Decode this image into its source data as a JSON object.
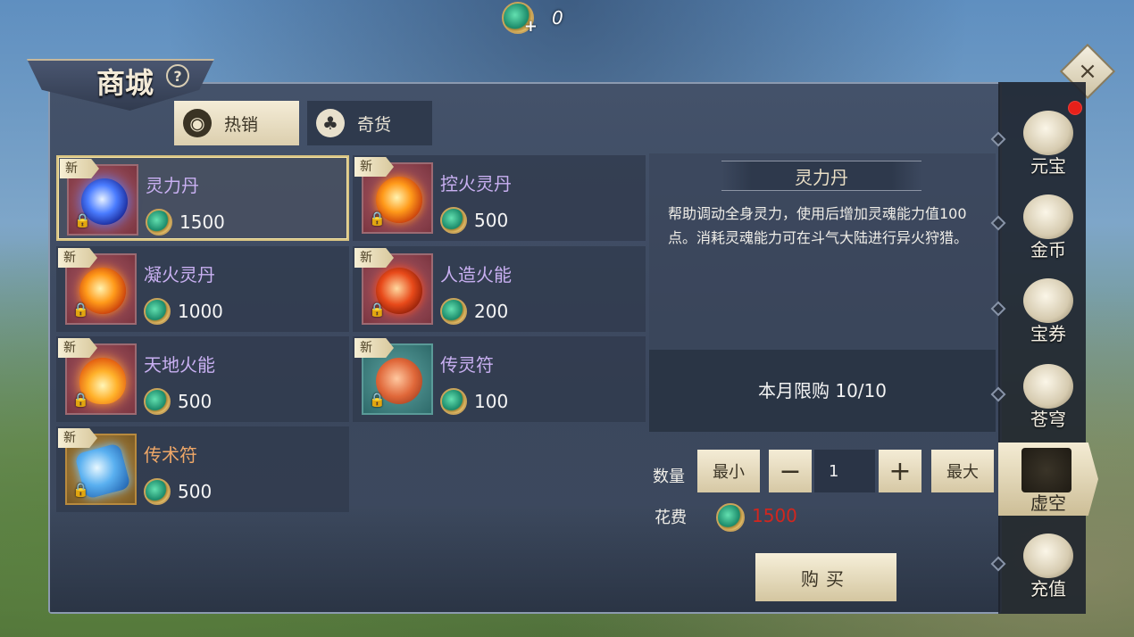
{
  "top_currency": {
    "icon": "jade-coin-icon",
    "value": "0"
  },
  "window": {
    "title": "商城",
    "help": "?",
    "close": "×"
  },
  "tabs": [
    {
      "label": "热销",
      "icon": "hot-sale-icon",
      "active": true
    },
    {
      "label": "奇货",
      "icon": "treasure-bag-icon",
      "active": false
    }
  ],
  "items": [
    {
      "name": "灵力丹",
      "price": "1500",
      "badge": "新",
      "icon": "blue-orb-icon"
    },
    {
      "name": "控火灵丹",
      "price": "500",
      "badge": "新",
      "icon": "fire-orb-icon"
    },
    {
      "name": "凝火灵丹",
      "price": "1000",
      "badge": "新",
      "icon": "fire-orb-icon"
    },
    {
      "name": "人造火能",
      "price": "200",
      "badge": "新",
      "icon": "red-orb-icon"
    },
    {
      "name": "天地火能",
      "price": "500",
      "badge": "新",
      "icon": "flame-icon"
    },
    {
      "name": "传灵符",
      "price": "100",
      "badge": "新",
      "icon": "rune-icon"
    },
    {
      "name": "传术符",
      "price": "500",
      "badge": "新",
      "icon": "crystal-icon"
    }
  ],
  "detail": {
    "title": "灵力丹",
    "description": "帮助调动全身灵力，使用后增加灵魂能力值100点。消耗灵魂能力可在斗气大陆进行异火狩猎。",
    "limit": "本月限购 10/10",
    "qty_label": "数量",
    "min_label": "最小",
    "minus": "−",
    "quantity": "1",
    "plus": "+",
    "max_label": "最大",
    "cost_label": "花费",
    "cost_value": "1500",
    "buy_label": "购买"
  },
  "sidebar": [
    {
      "label": "元宝",
      "icon": "ingot-icon",
      "active": false,
      "notify": true
    },
    {
      "label": "金币",
      "icon": "gold-coin-icon",
      "active": false
    },
    {
      "label": "宝券",
      "icon": "voucher-icon",
      "active": false
    },
    {
      "label": "苍穹",
      "icon": "sky-orb-icon",
      "active": false
    },
    {
      "label": "虚空",
      "icon": "void-gate-icon",
      "active": true
    },
    {
      "label": "充值",
      "icon": "coin-stack-icon",
      "active": false
    }
  ],
  "colors": {
    "item_name": "#c9b0f2",
    "item_name_alt": "#f0a868",
    "cost": "#d2261e",
    "accent": "#d9c482"
  }
}
